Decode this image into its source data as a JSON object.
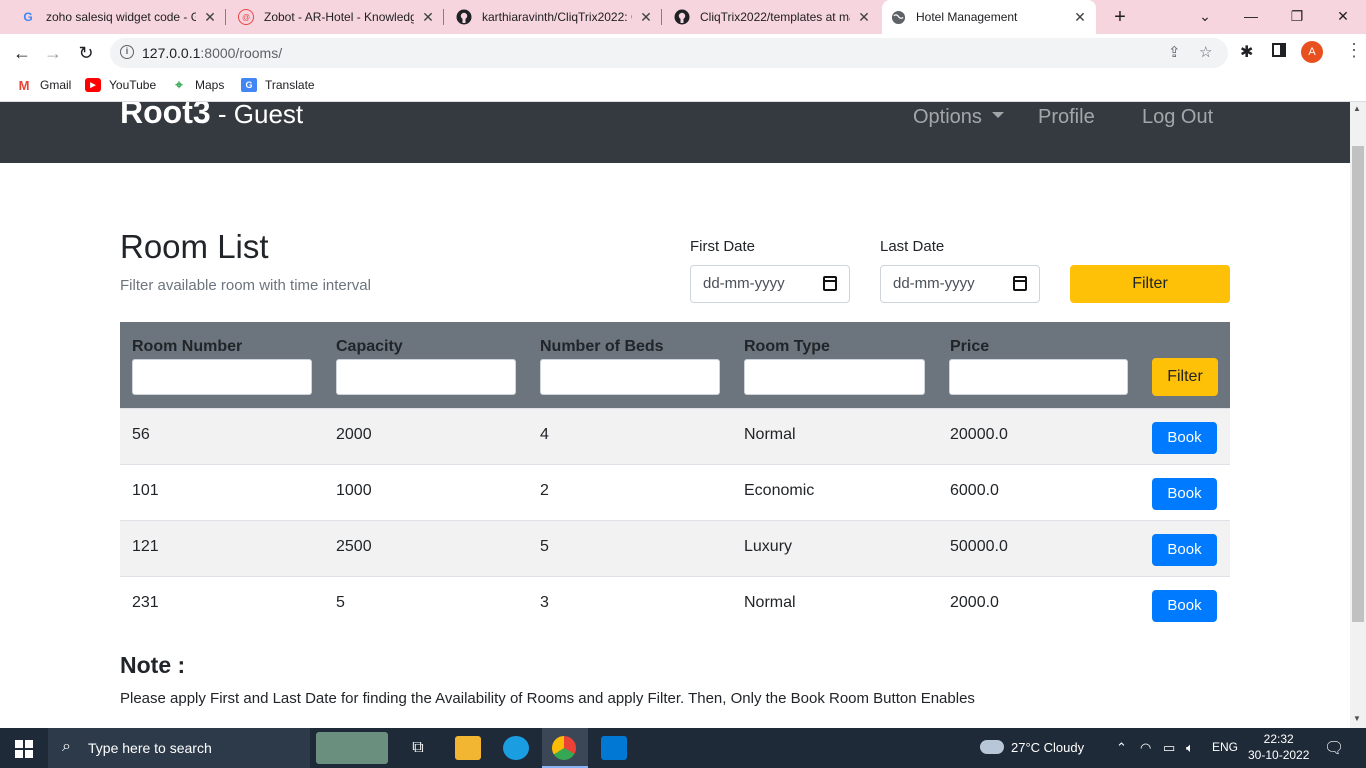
{
  "browser": {
    "tabs": [
      {
        "title": "zoho salesiq widget code - G",
        "icon": "google-icon"
      },
      {
        "title": "Zobot - AR-Hotel - Knowledg",
        "icon": "zoho-icon"
      },
      {
        "title": "karthiaravinth/CliqTrix2022: C",
        "icon": "github-icon"
      },
      {
        "title": "CliqTrix2022/templates at ma",
        "icon": "github-icon"
      },
      {
        "title": "Hotel Management",
        "icon": "globe-icon"
      }
    ],
    "url_host": "127.0.0.1",
    "url_path": ":8000/rooms/",
    "avatar_letter": "A",
    "bookmarks": [
      {
        "label": "Gmail",
        "icon": "gmail-icon"
      },
      {
        "label": "YouTube",
        "icon": "youtube-icon"
      },
      {
        "label": "Maps",
        "icon": "maps-icon"
      },
      {
        "label": "Translate",
        "icon": "translate-icon"
      }
    ]
  },
  "navbar": {
    "brand": "Root3",
    "separator": " - ",
    "role": "Guest",
    "options": "Options",
    "profile": "Profile",
    "logout": "Log Out"
  },
  "header": {
    "title": "Room List",
    "subtitle": "Filter available room with time interval",
    "first_date_label": "First Date",
    "last_date_label": "Last Date",
    "date_placeholder": "dd-mm-yyyy",
    "filter_label": "Filter"
  },
  "table": {
    "columns": [
      "Room Number",
      "Capacity",
      "Number of Beds",
      "Room Type",
      "Price"
    ],
    "filter_label": "Filter",
    "book_label": "Book",
    "rows": [
      {
        "room": "56",
        "capacity": "2000",
        "beds": "4",
        "type": "Normal",
        "price": "20000.0"
      },
      {
        "room": "101",
        "capacity": "1000",
        "beds": "2",
        "type": "Economic",
        "price": "6000.0"
      },
      {
        "room": "121",
        "capacity": "2500",
        "beds": "5",
        "type": "Luxury",
        "price": "50000.0"
      },
      {
        "room": "231",
        "capacity": "5",
        "beds": "3",
        "type": "Normal",
        "price": "2000.0"
      }
    ]
  },
  "note": {
    "title": "Note :",
    "text": "Please apply First and Last Date for finding the Availability of Rooms and apply Filter. Then, Only the Book Room Button Enables"
  },
  "taskbar": {
    "search_placeholder": "Type here to search",
    "weather": "27°C  Cloudy",
    "language": "ENG",
    "time": "22:32",
    "date": "30-10-2022"
  },
  "colors": {
    "navbar": "#343a40",
    "table_header": "#6c757d",
    "filter_button": "#ffc107",
    "book_button": "#007bff",
    "tabbar": "#f6d5de"
  }
}
